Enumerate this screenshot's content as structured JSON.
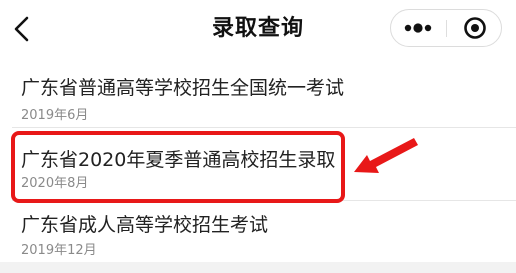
{
  "nav": {
    "title": "录取查询",
    "back_icon": "chevron-left-icon",
    "more_icon": "more-dots-icon",
    "close_icon": "target-circle-icon"
  },
  "list": {
    "items": [
      {
        "title": "广东省普通高等学校招生全国统一考试",
        "date": "2019年6月"
      },
      {
        "title": "广东省2020年夏季普通高校招生录取",
        "date": "2020年8月",
        "highlighted": true
      },
      {
        "title": "广东省成人高等学校招生考试",
        "date": "2019年12月"
      }
    ]
  },
  "annotation": {
    "highlight_color": "#e81818"
  }
}
